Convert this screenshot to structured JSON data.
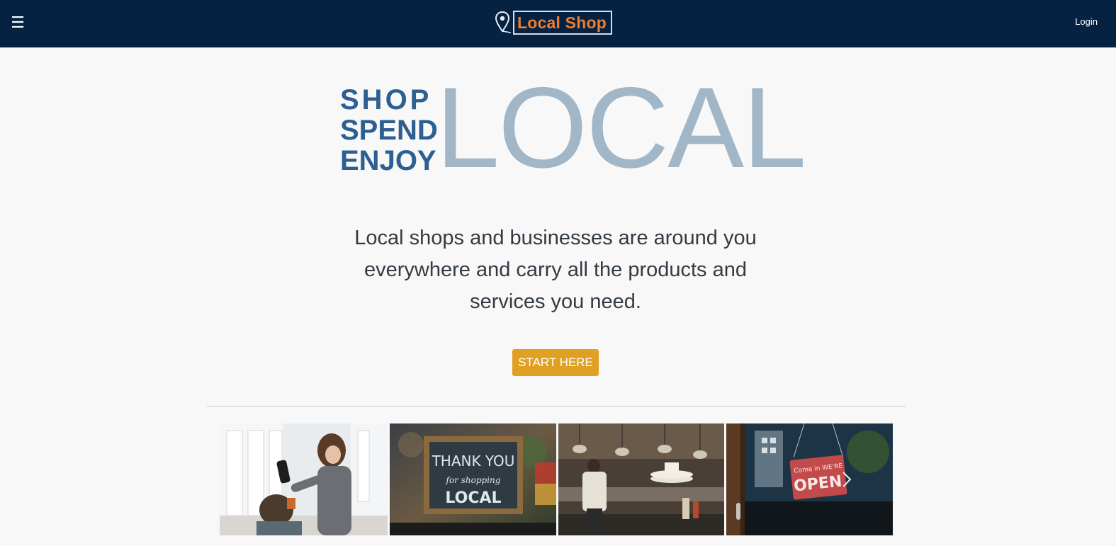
{
  "header": {
    "menu_icon": "hamburger-menu-icon",
    "logo_icon": "map-pin-icon",
    "brand": "Local Shop",
    "login_label": "Login",
    "colors": {
      "bar": "#052242",
      "brand_text": "#f07d2e"
    }
  },
  "hero": {
    "stack": [
      "SHOP",
      "SPEND",
      "ENJOY"
    ],
    "big_word": "LOCAL",
    "colors": {
      "stack": "#2e5f92",
      "big_word": "#a1b6c7"
    }
  },
  "intro": {
    "text": "Local shops and businesses are around you everywhere and carry all the products and services you need."
  },
  "cta": {
    "label": "START HERE",
    "color": "#e0a023"
  },
  "gallery": {
    "tiles": [
      {
        "name": "hair-salon-photo"
      },
      {
        "name": "thank-you-sign-photo",
        "sign_lines": [
          "THANK YOU",
          "for shopping",
          "LOCAL"
        ]
      },
      {
        "name": "restaurant-kitchen-photo"
      },
      {
        "name": "open-sign-photo",
        "sign_lines": [
          "Come in WE'RE",
          "OPEN"
        ]
      }
    ],
    "next_icon": "chevron-right-icon"
  }
}
